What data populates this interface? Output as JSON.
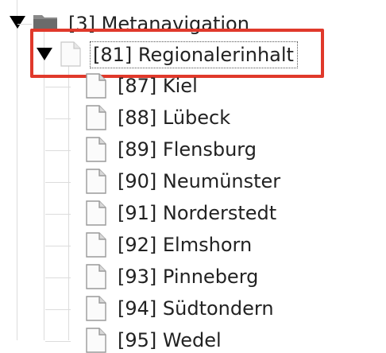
{
  "tree": {
    "parent": {
      "label": "[3] Metanavigation",
      "icon": "folder-icon",
      "expanded": true
    },
    "selected": {
      "label": "[81] Regionalerinhalt",
      "icon": "page-icon",
      "expanded": true
    },
    "children": [
      {
        "label": "[87] Kiel"
      },
      {
        "label": "[88] Lübeck"
      },
      {
        "label": "[89] Flensburg"
      },
      {
        "label": "[90] Neumünster"
      },
      {
        "label": "[91] Norderstedt"
      },
      {
        "label": "[92] Elmshorn"
      },
      {
        "label": "[93] Pinneberg"
      },
      {
        "label": "[94] Südtondern"
      },
      {
        "label": "[95] Wedel"
      }
    ]
  },
  "colors": {
    "highlight": "#e0392b",
    "guide_lines": "#dcdcdc"
  }
}
